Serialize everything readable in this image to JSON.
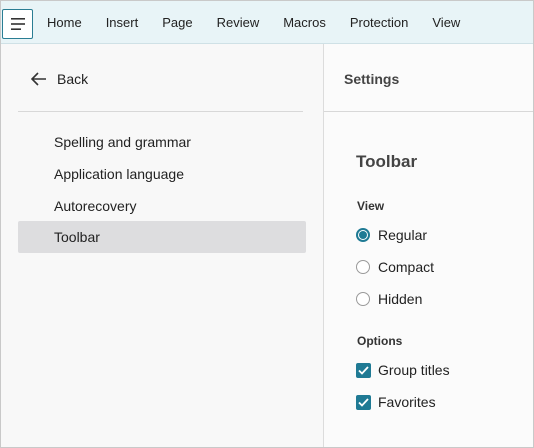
{
  "ribbon": {
    "menu_icon": "hamburger-menu-icon",
    "tabs": [
      "Home",
      "Insert",
      "Page",
      "Review",
      "Macros",
      "Protection",
      "View"
    ]
  },
  "sidebar": {
    "back_icon": "arrow-left-icon",
    "back_label": "Back",
    "items": [
      {
        "label": "Spelling and grammar",
        "active": false
      },
      {
        "label": "Application language",
        "active": false
      },
      {
        "label": "Autorecovery",
        "active": false
      },
      {
        "label": "Toolbar",
        "active": true
      }
    ]
  },
  "main": {
    "header": "Settings",
    "section_title": "Toolbar",
    "view_group": {
      "label": "View",
      "options": [
        {
          "label": "Regular",
          "selected": true
        },
        {
          "label": "Compact",
          "selected": false
        },
        {
          "label": "Hidden",
          "selected": false
        }
      ]
    },
    "options_group": {
      "label": "Options",
      "checkboxes": [
        {
          "label": "Group titles",
          "checked": true
        },
        {
          "label": "Favorites",
          "checked": true
        }
      ]
    }
  },
  "colors": {
    "accent": "#1f7a94",
    "tabbar_bg": "#e8f4f7",
    "active_item_bg": "#dddddf"
  }
}
